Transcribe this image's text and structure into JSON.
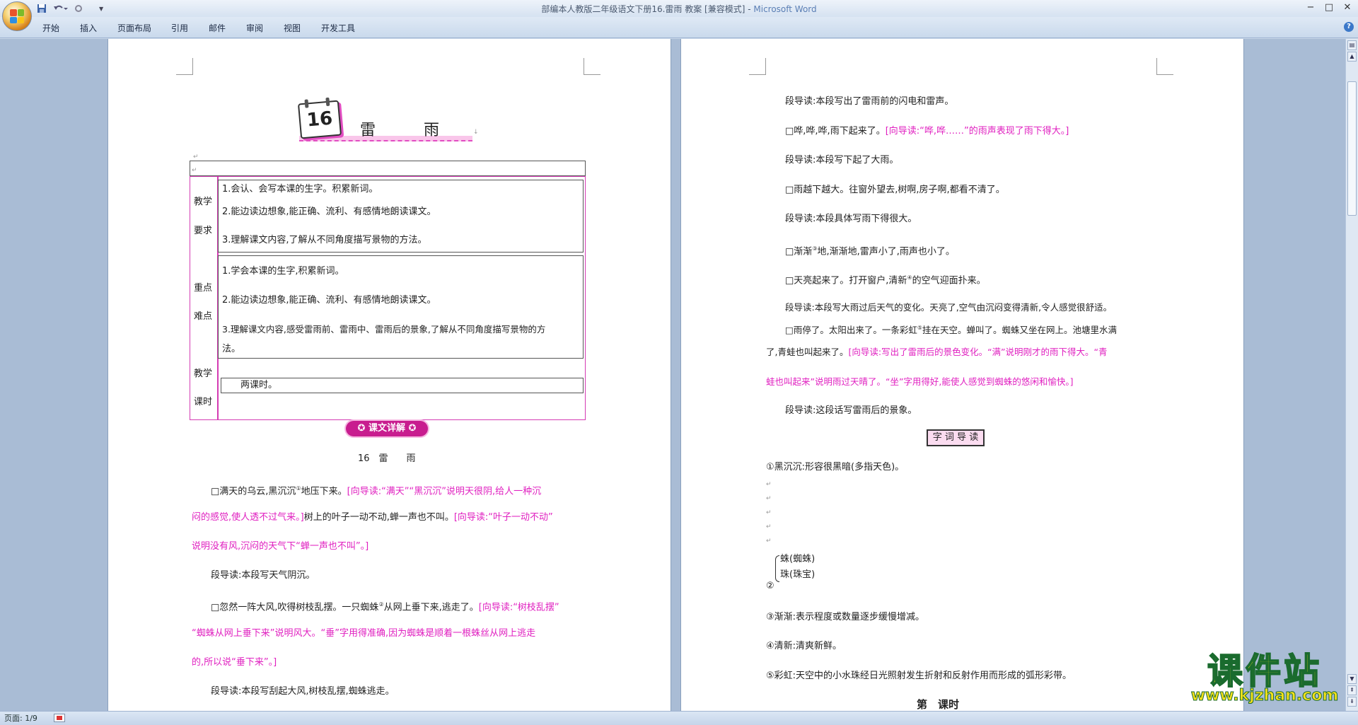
{
  "window": {
    "title": "部编本人教版二年级语文下册16.雷雨 教案 [兼容模式]",
    "app_name": "Microsoft Word",
    "minimize": "−",
    "maximize": "□",
    "close": "✕"
  },
  "qat": {
    "save_icon": "save-icon",
    "undo_icon": "undo-icon",
    "redo_icon": "redo-icon",
    "more": "▼"
  },
  "ribbon": {
    "tabs": [
      "开始",
      "插入",
      "页面布局",
      "引用",
      "邮件",
      "审阅",
      "视图",
      "开发工具"
    ]
  },
  "page1": {
    "lesson_number": "16",
    "lesson_title_1": "雷",
    "lesson_title_2": "雨",
    "table": {
      "req_label_1": "教学",
      "req_label_2": "要求",
      "req_items": [
        "1.会认、会写本课的生字。积累新词。",
        "2.能边读边想象,能正确、流利、有感情地朗读课文。",
        "3.理解课文内容,了解从不同角度描写景物的方法。"
      ],
      "key_label_1": "重点",
      "key_label_2": "难点",
      "key_items": [
        "1.学会本课的生字,积累新词。",
        "2.能边读边想象,能正确、流利、有感情地朗读课文。",
        "3.理解课文内容,感受雷雨前、雷雨中、雷雨后的景象,了解从不同角度描写景物的方",
        "法。"
      ],
      "time_label_1": "教学",
      "time_label_2": "课时",
      "time_value": "两课时。"
    },
    "section_badge": "课文详解",
    "section_title": "16　雷　　雨",
    "p1a": "满天的乌云,黑沉沉",
    "p1a_sup": "①",
    "p1b": "地压下来。",
    "p1c": "[向导读:“满天”“黑沉沉”说明天很阴,给人一种沉",
    "p1d": "闷的感觉,使人透不过气来。]",
    "p1e": "树上的叶子一动不动,蝉一声也不叫。",
    "p1f": "[向导读:“叶子一动不动”",
    "p1g": "说明没有风,沉闷的天气下“蝉一声也不叫”。]",
    "p2": "段导读:本段写天气阴沉。",
    "p3a": "忽然一阵大风,吹得树枝乱摆。一只蜘蛛",
    "p3_sup": "②",
    "p3b": "从网上垂下来,逃走了。",
    "p3c": "[向导读:“树枝乱摆”",
    "p3d": "“蜘蛛从网上垂下来”说明风大。“垂”字用得准确,因为蜘蛛是顺着一根蛛丝从网上逃走",
    "p3e": "的,所以说“垂下来”。]",
    "p4": "段导读:本段写刮起大风,树枝乱摆,蜘蛛逃走。"
  },
  "page2": {
    "l1": "段导读:本段写出了雷雨前的闪电和雷声。",
    "l2a": "哗,哗,哗,雨下起来了。",
    "l2b": "[向导读:“哗,哗……”的雨声表现了雨下得大。]",
    "l3": "段导读:本段写下起了大雨。",
    "l4": "雨越下越大。往窗外望去,树啊,房子啊,都看不清了。",
    "l5": "段导读:本段具体写雨下得很大。",
    "l6a": "渐渐",
    "l6_sup": "③",
    "l6b": "地,渐渐地,雷声小了,雨声也小了。",
    "l7a": "天亮起来了。打开窗户,清新",
    "l7_sup": "④",
    "l7b": "的空气迎面扑来。",
    "l8": "段导读:本段写大雨过后天气的变化。天亮了,空气由沉闷变得清新,令人感觉很舒适。",
    "l9a": "雨停了。太阳出来了。一条彩虹",
    "l9_sup": "⑤",
    "l9b": "挂在天空。蝉叫了。蜘蛛又坐在网上。池塘里水满",
    "l10a": "了,青蛙也叫起来了。",
    "l10b": "[向导读:写出了雷雨后的景色变化。“满”说明刚才的雨下得大。“青",
    "l11": "蛙也叫起来”说明雨过天晴了。“坐”字用得好,能使人感觉到蜘蛛的悠闲和愉快。]",
    "l12": "段导读:这段话写雷雨后的景象。",
    "word_box": "字 词 导 读",
    "w1": "①黑沉沉:形容很黑暗(多指天色)。",
    "w2_num": "②",
    "w2a": "蛛(蜘蛛)",
    "w2b": "珠(珠宝)",
    "w3": "③渐渐:表示程度或数量逐步缓慢增减。",
    "w4": "④清新:清爽新鲜。",
    "w5": "⑤彩虹:天空中的小水珠经日光照射发生折射和反射作用而形成的弧形彩带。",
    "w6": "第　课时"
  },
  "status": {
    "page": "页面: 1/9"
  },
  "watermark": {
    "name": "课件站",
    "url": "www.kjzhan.com"
  },
  "colors": {
    "guide_text": "#e020c0",
    "ribbon": "#c9d9ec",
    "workspace": "#a9bcd5"
  }
}
